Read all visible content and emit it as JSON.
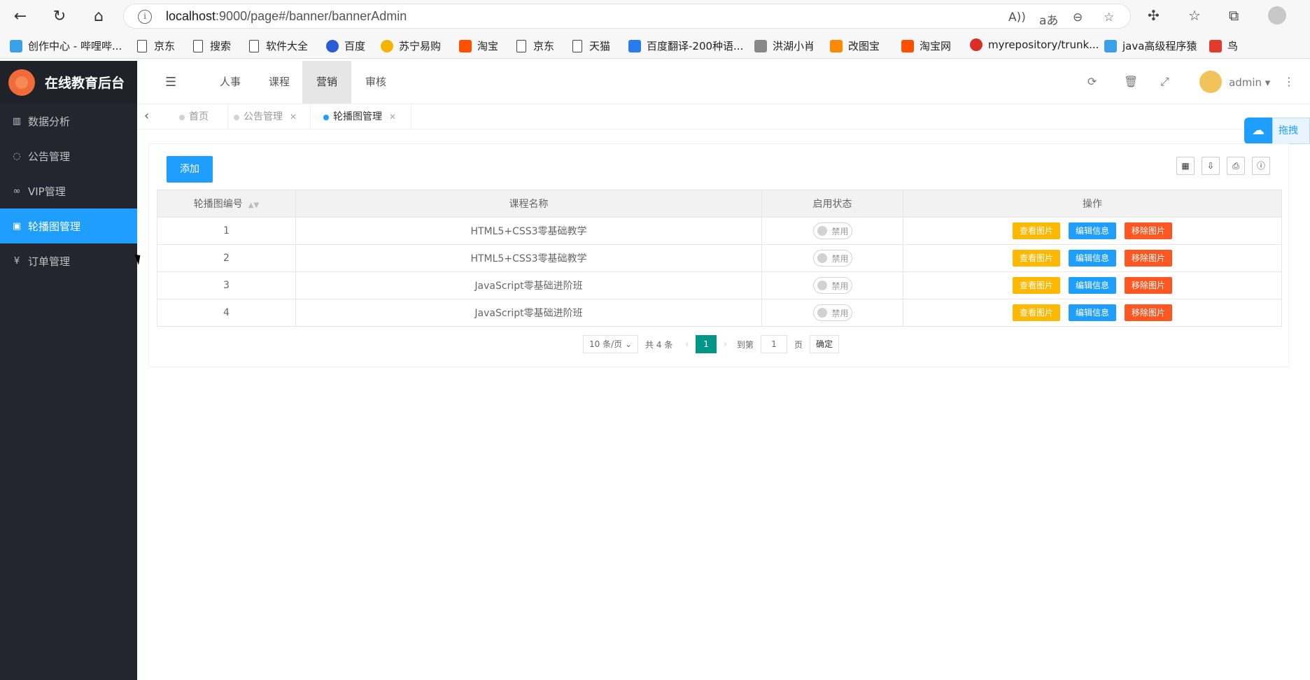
{
  "browser": {
    "url_host": "localhost",
    "url_rest": ":9000/page#/banner/bannerAdmin",
    "bookmarks": [
      {
        "label": "创作中心 - 哔哩哔...",
        "color": "#3aa0e8"
      },
      {
        "label": "京东",
        "color": ""
      },
      {
        "label": "搜索",
        "color": ""
      },
      {
        "label": "软件大全",
        "color": ""
      },
      {
        "label": "百度",
        "color": "#2a5bd7"
      },
      {
        "label": "苏宁易购",
        "color": "#f5b400"
      },
      {
        "label": "淘宝",
        "color": "#ff5000"
      },
      {
        "label": "京东",
        "color": ""
      },
      {
        "label": "天猫",
        "color": ""
      },
      {
        "label": "百度翻译-200种语...",
        "color": "#2b7bf0"
      },
      {
        "label": "洪湖小肖",
        "color": "#888888"
      },
      {
        "label": "改图宝",
        "color": "#ff8a00"
      },
      {
        "label": "淘宝网",
        "color": "#ff5000"
      },
      {
        "label": "myrepository/trunk...",
        "color": "#d93025"
      },
      {
        "label": "java高级程序猿",
        "color": "#3aa0e8"
      },
      {
        "label": "鸟",
        "color": "#e23b2e"
      }
    ]
  },
  "app": {
    "logo_text": "在线教育后台",
    "sidebar": [
      {
        "label": "数据分析",
        "icon": "bar-chart-icon",
        "glyph": "▥"
      },
      {
        "label": "公告管理",
        "icon": "chat-icon",
        "glyph": "◌"
      },
      {
        "label": "VIP管理",
        "icon": "link-icon",
        "glyph": "∞"
      },
      {
        "label": "轮播图管理",
        "icon": "image-icon",
        "glyph": "▣"
      },
      {
        "label": "订单管理",
        "icon": "yen-icon",
        "glyph": "¥"
      }
    ],
    "top_tabs": [
      "人事",
      "课程",
      "营销",
      "审核"
    ],
    "admin_name": "admin",
    "page_tabs": [
      {
        "label": "首页"
      },
      {
        "label": "公告管理"
      },
      {
        "label": "轮播图管理"
      }
    ],
    "float_label": "拖拽"
  },
  "table": {
    "add_label": "添加",
    "columns": [
      "轮播图编号",
      "课程名称",
      "启用状态",
      "操作"
    ],
    "rows": [
      {
        "id": "1",
        "course": "HTML5+CSS3零基础教学",
        "status": "禁用"
      },
      {
        "id": "2",
        "course": "HTML5+CSS3零基础教学",
        "status": "禁用"
      },
      {
        "id": "3",
        "course": "JavaScript零基础进阶班",
        "status": "禁用"
      },
      {
        "id": "4",
        "course": "JavaScript零基础进阶班",
        "status": "禁用"
      }
    ],
    "actions": {
      "view": "查看图片",
      "edit": "编辑信息",
      "delete": "移除图片"
    }
  },
  "pager": {
    "page_size": "10 条/页",
    "total": "共 4 条",
    "current": "1",
    "goto_label": "到第",
    "goto_value": "1",
    "page_unit": "页",
    "confirm": "确定"
  },
  "colors": {
    "primary": "#1E9FFF",
    "warn": "#FFB800",
    "danger": "#FF5722",
    "teal": "#009688",
    "sidebar": "#23262e"
  }
}
